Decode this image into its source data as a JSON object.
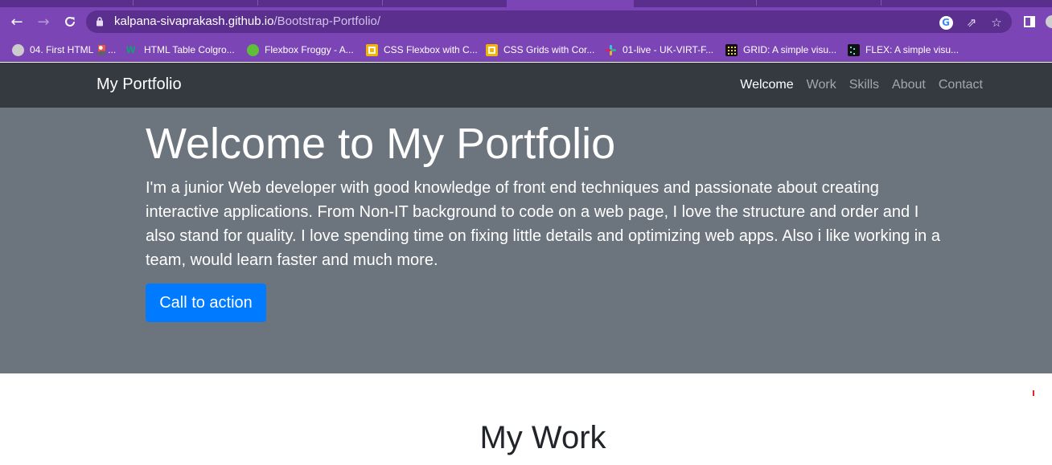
{
  "browser": {
    "url_host": "kalpana-sivaprakash.github.io",
    "url_path": "/Bootstrap-Portfolio/",
    "nav_icons": {
      "back": "back-arrow-icon",
      "forward": "forward-arrow-icon",
      "reload": "reload-icon"
    },
    "omnibox_icons": [
      "lock-icon",
      "google-icon",
      "share-icon",
      "star-icon"
    ],
    "toolbar_icons": [
      "sidebar-icon",
      "profile-icon"
    ],
    "bookmarks": [
      {
        "label": "04. First HTML 🎴...",
        "icon": "github-icon",
        "color": "#cccccc"
      },
      {
        "label": "HTML Table Colgro...",
        "icon": "w3-icon",
        "color": "#04aa6d"
      },
      {
        "label": "Flexbox Froggy - A...",
        "icon": "frog-icon",
        "color": "#5fbf3a"
      },
      {
        "label": "CSS Flexbox with C...",
        "icon": "slides-icon",
        "color": "#f4b400"
      },
      {
        "label": "CSS Grids with Cor...",
        "icon": "slides-icon",
        "color": "#f4b400"
      },
      {
        "label": "01-live - UK-VIRT-F...",
        "icon": "slack-icon",
        "color": "#e01e5a"
      },
      {
        "label": "GRID: A simple visu...",
        "icon": "grid-icon",
        "color": "#111111"
      },
      {
        "label": "FLEX: A simple visu...",
        "icon": "flex-icon",
        "color": "#111111"
      }
    ]
  },
  "site": {
    "brand": "My Portfolio",
    "nav": [
      "Welcome",
      "Work",
      "Skills",
      "About",
      "Contact"
    ],
    "active_nav": "Welcome",
    "hero": {
      "title": "Welcome to My Portfolio",
      "lead": "I'm a junior Web developer with good knowledge of front end techniques and passionate about creating interactive applications. From Non-IT background to code on a web page, I love the structure and order and I also stand for quality. I love spending time on fixing little details and optimizing web apps. Also i like working in a team, would learn faster and much more.",
      "cta": "Call to action"
    },
    "work_title": "My Work"
  },
  "colors": {
    "chrome_purple": "#7b45b5",
    "navbar_dark": "#343a40",
    "hero_gray": "#6c757d",
    "primary_blue": "#007bff"
  }
}
